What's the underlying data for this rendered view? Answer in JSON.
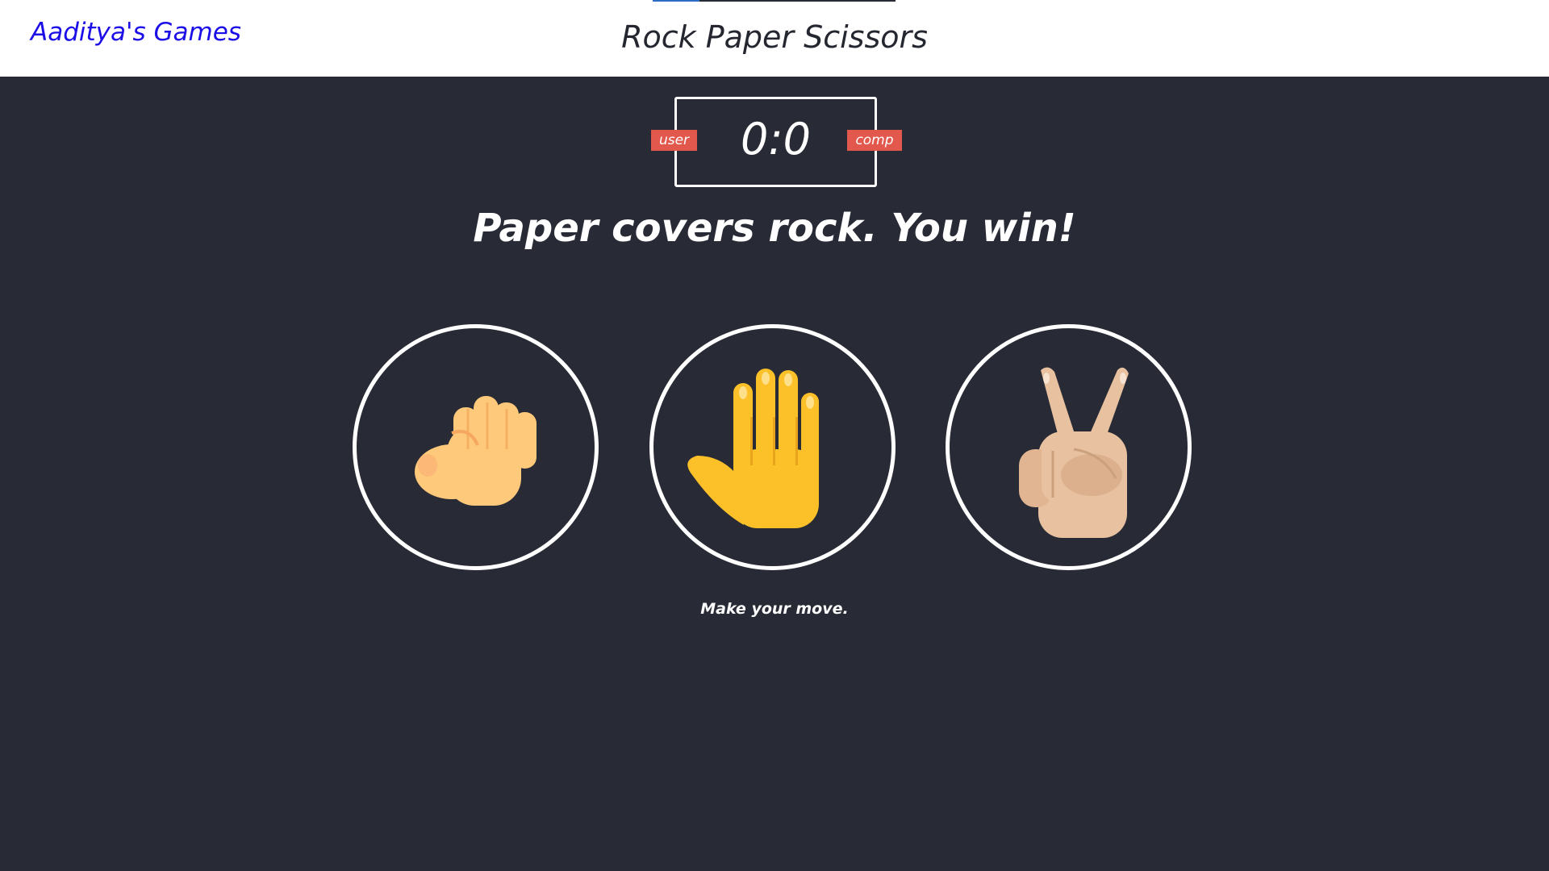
{
  "header": {
    "brand": "Aaditya's Games",
    "title": "Rock Paper Scissors"
  },
  "scoreboard": {
    "score": "0:0",
    "user_label": "user",
    "comp_label": "comp"
  },
  "result": {
    "message": "Paper covers rock. You win!"
  },
  "choices": [
    {
      "name": "rock",
      "icon": "raised-fist-icon"
    },
    {
      "name": "paper",
      "icon": "raised-hand-icon"
    },
    {
      "name": "scissors",
      "icon": "victory-hand-icon"
    }
  ],
  "prompt": "Make your move.",
  "colors": {
    "background": "#282b35",
    "header": "#ffffff",
    "brand_link": "#1c0ee6",
    "badge": "#e2584d"
  }
}
